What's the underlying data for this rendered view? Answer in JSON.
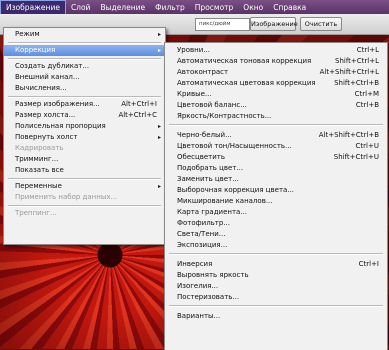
{
  "menubar": [
    {
      "label": "Изображение",
      "active": true
    },
    {
      "label": "Слой"
    },
    {
      "label": "Выделение"
    },
    {
      "label": "Фильтр"
    },
    {
      "label": "Просмотр"
    },
    {
      "label": "Окно"
    },
    {
      "label": "Справка"
    }
  ],
  "options": {
    "dropdown_value": "пикс/дюйм",
    "image_button": "Изображение",
    "clear_button": "Очистить"
  },
  "main_menu": [
    {
      "label": "Режим",
      "arrow": true
    },
    {
      "sep": true
    },
    {
      "label": "Коррекция",
      "arrow": true,
      "hl": true
    },
    {
      "sep": true
    },
    {
      "label": "Создать дубликат..."
    },
    {
      "label": "Внешний канал..."
    },
    {
      "label": "Вычисления..."
    },
    {
      "sep": true
    },
    {
      "label": "Размер изображения...",
      "shortcut": "Alt+Ctrl+I"
    },
    {
      "label": "Размер холста...",
      "shortcut": "Alt+Ctrl+C"
    },
    {
      "label": "Полисельная пропорция",
      "arrow": true
    },
    {
      "label": "Повернуть холст",
      "arrow": true
    },
    {
      "label": "Кадрировать",
      "disabled": true
    },
    {
      "label": "Тримминг..."
    },
    {
      "label": "Показать все"
    },
    {
      "sep": true
    },
    {
      "label": "Переменные",
      "arrow": true
    },
    {
      "label": "Применить набор данных...",
      "disabled": true
    },
    {
      "sep": true
    },
    {
      "label": "Треппинг...",
      "disabled": true
    }
  ],
  "sub_menu": [
    {
      "label": "Уровни...",
      "shortcut": "Ctrl+L"
    },
    {
      "label": "Автоматическая тоновая коррекция",
      "shortcut": "Shift+Ctrl+L"
    },
    {
      "label": "Автоконтраст",
      "shortcut": "Alt+Shift+Ctrl+L"
    },
    {
      "label": "Автоматическая цветовая коррекция",
      "shortcut": "Shift+Ctrl+B"
    },
    {
      "label": "Кривые...",
      "shortcut": "Ctrl+M"
    },
    {
      "label": "Цветовой баланс...",
      "shortcut": "Ctrl+B"
    },
    {
      "label": "Яркость/Контрастность..."
    },
    {
      "sep": true
    },
    {
      "label": "Черно-белый...",
      "shortcut": "Alt+Shift+Ctrl+B"
    },
    {
      "label": "Цветовой тон/Насыщенность...",
      "shortcut": "Ctrl+U"
    },
    {
      "label": "Обесцветить",
      "shortcut": "Shift+Ctrl+U"
    },
    {
      "label": "Подобрать цвет..."
    },
    {
      "label": "Заменить цвет..."
    },
    {
      "label": "Выборочная коррекция цвета..."
    },
    {
      "label": "Микширование каналов..."
    },
    {
      "label": "Карта градиента..."
    },
    {
      "label": "Фотофильтр..."
    },
    {
      "label": "Света/Тени..."
    },
    {
      "label": "Экспозиция..."
    },
    {
      "sep": true
    },
    {
      "label": "Инверсия",
      "shortcut": "Ctrl+I"
    },
    {
      "label": "Выровнять яркость"
    },
    {
      "label": "Изогелия..."
    },
    {
      "label": "Постеризовать..."
    },
    {
      "sep": true
    },
    {
      "label": "Варианты..."
    }
  ]
}
